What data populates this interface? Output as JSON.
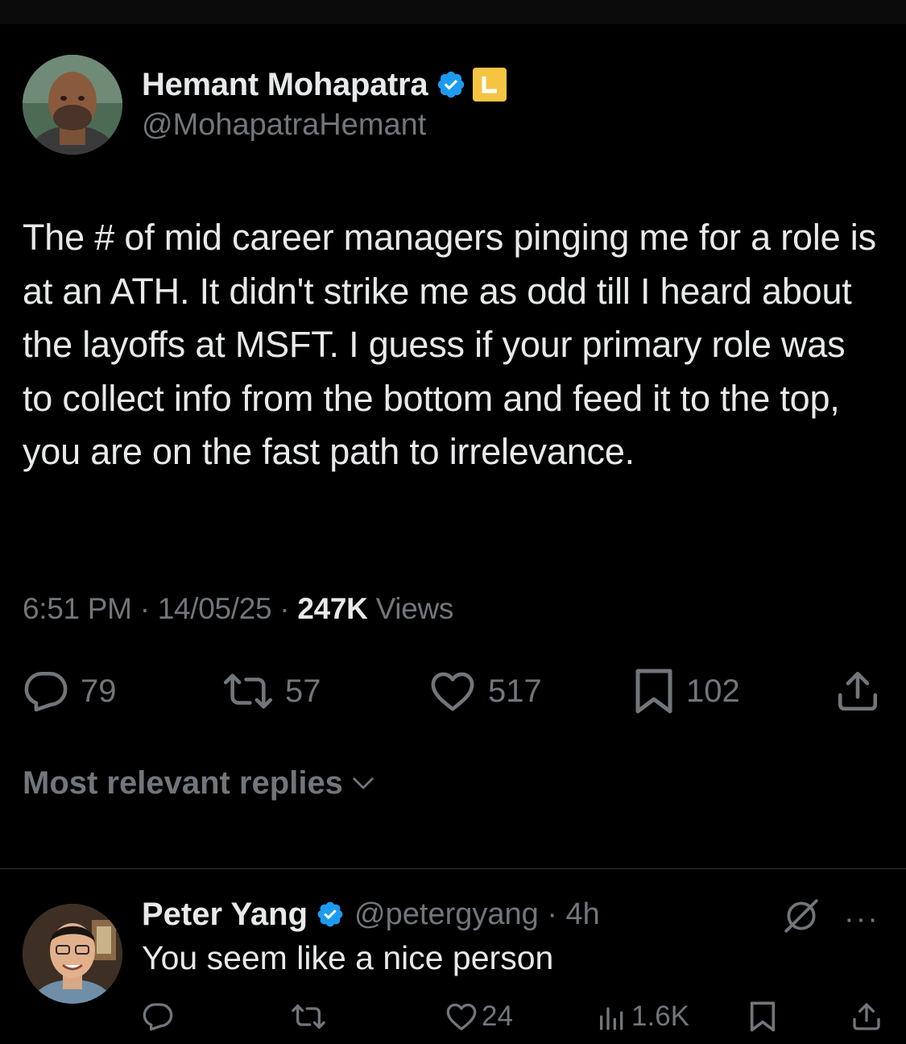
{
  "tweet": {
    "author_name": "Hemant Mohapatra",
    "author_handle": "@MohapatraHemant",
    "text": "The # of mid career managers pinging me for a role is at an ATH. It didn't strike me as odd till I heard about the layoffs at MSFT. I guess if your primary role was to collect info from the bottom and feed it to the top, you are on the fast path to irrelevance.",
    "time": "6:51 PM",
    "date": "14/05/25",
    "views_count": "247K",
    "views_label": "Views",
    "sep": "·",
    "stats": {
      "replies": "79",
      "reposts": "57",
      "likes": "517",
      "bookmarks": "102"
    }
  },
  "replies_sort": {
    "label": "Most relevant replies"
  },
  "reply": {
    "author_name": "Peter Yang",
    "handle_time": "@petergyang · 4h",
    "more": "···",
    "text": "You seem like a nice person",
    "stats": {
      "likes": "24",
      "views": "1.6K"
    }
  },
  "colors": {
    "background": "#000000",
    "text_primary": "#e7e9ea",
    "text_secondary": "#71767b",
    "verified_blue": "#1d9bf0",
    "org_badge_gold": "#f5c443",
    "divider": "#2f3336"
  },
  "icons": [
    "verified-icon",
    "org-badge-icon",
    "reply-icon",
    "repost-icon",
    "like-icon",
    "bookmark-icon",
    "share-icon",
    "chevron-down-icon",
    "grok-icon",
    "more-icon",
    "views-icon"
  ]
}
